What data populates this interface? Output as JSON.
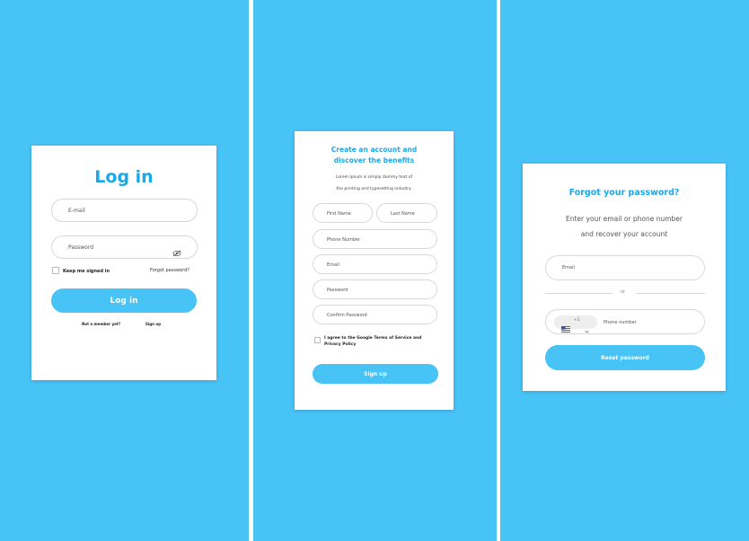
{
  "login": {
    "title": "Log in",
    "email_placeholder": "E-mail",
    "password_placeholder": "Password",
    "keep_signed_in": "Keep me signed in",
    "forgot_link": "Forgot password?",
    "login_button": "Log in",
    "no_account_text": "Not a member yet?",
    "sign_up_link": "Sign up"
  },
  "signup": {
    "title_line1": "Create an account and",
    "title_line2": "discover the benefits",
    "desc_line1": "Lorem Ipsum is simply dummy text of",
    "desc_line2": "the printing and typesetting industry.",
    "first_name": "First Name",
    "last_name": "Last Name",
    "phone": "Phone Number",
    "email": "Email",
    "password": "Password",
    "confirm_password": "Confirm Password",
    "terms_line1": "I agree to the Google Terms of Service and",
    "terms_line2": "Privacy Policy",
    "sign_up_button": "Sign up"
  },
  "forgot": {
    "title": "Forgot your password?",
    "desc_line1": "Enter your email or phone number",
    "desc_line2": "and recover your account",
    "email_placeholder": "Email",
    "or_text": "or",
    "country_code": "+1",
    "phone_placeholder": "Phone number",
    "reset_button": "Reset password"
  },
  "colors": {
    "background_blue": "#47c3f6",
    "title_blue": "#1aa9e8",
    "card": "#ffffff"
  },
  "icons": {
    "password_visibility": "eye-off-icon",
    "country_flag": "us-flag-icon",
    "dropdown": "chevron-down-icon"
  }
}
